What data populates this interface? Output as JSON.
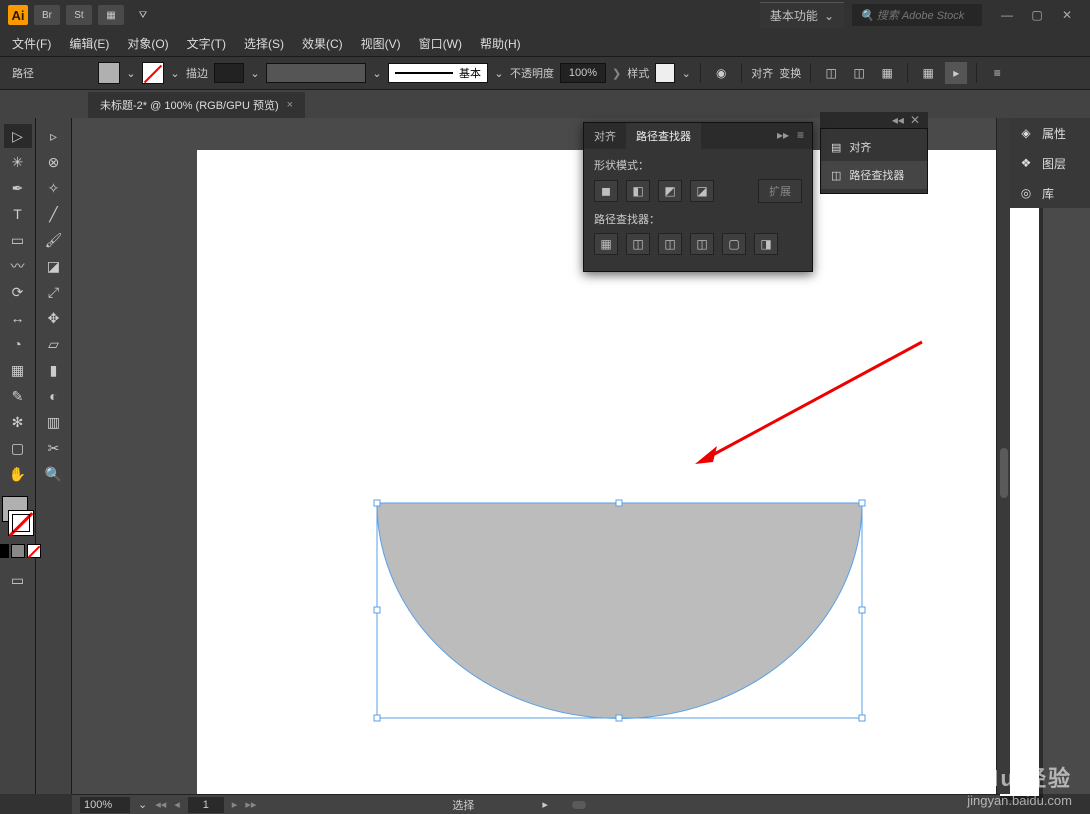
{
  "app": {
    "icon_label": "Ai",
    "workspace": "基本功能",
    "search_placeholder": "搜索 Adobe Stock"
  },
  "menu": {
    "file": "文件(F)",
    "edit": "编辑(E)",
    "object": "对象(O)",
    "type": "文字(T)",
    "select": "选择(S)",
    "effect": "效果(C)",
    "view": "视图(V)",
    "window": "窗口(W)",
    "help": "帮助(H)"
  },
  "props": {
    "path": "路径",
    "stroke": "描边",
    "style_basic": "基本",
    "opacity_label": "不透明度",
    "opacity_value": "100%",
    "graphic_style": "样式",
    "align": "对齐",
    "transform": "变换"
  },
  "tab": {
    "doc_title": "未标题-2* @ 100% (RGB/GPU 预览)"
  },
  "panel": {
    "align_tab": "对齐",
    "pathfinder_tab": "路径查找器",
    "shape_modes": "形状模式：",
    "pathfinders": "路径查找器：",
    "expand": "扩展"
  },
  "flyout": {
    "align": "对齐",
    "pathfinder": "路径查找器"
  },
  "right_panel": {
    "properties": "属性",
    "layers": "图层",
    "libraries": "库"
  },
  "status": {
    "zoom": "100%",
    "page": "1",
    "selection": "选择"
  },
  "watermark": {
    "brand": "Baidu 经验",
    "url": "jingyan.baidu.com"
  }
}
